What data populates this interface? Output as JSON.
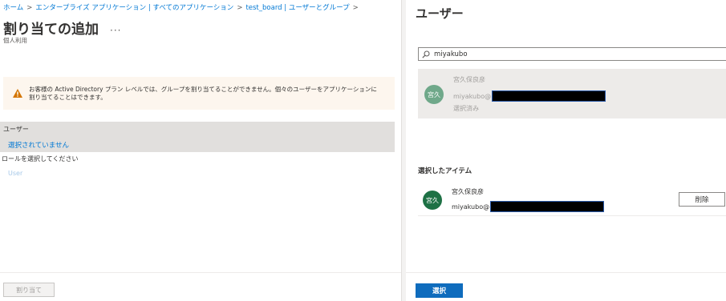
{
  "breadcrumb": {
    "items": [
      "ホーム",
      "エンタープライズ アプリケーション | すべてのアプリケーション",
      "test_board | ユーザーとグループ"
    ],
    "separator": ">"
  },
  "page": {
    "title": "割り当ての追加",
    "more": "···",
    "subtitle": "個人利用"
  },
  "warning": {
    "text": "お客様の Active Directory プラン レベルでは、グループを割り当てることができません。個々のユーザーをアプリケーションに割り当てることはできます。",
    "color": "#d47500"
  },
  "assignment": {
    "users_label": "ユーザー",
    "users_value": "選択されていません",
    "role_label": "ロールを選択してください",
    "role_value": "User"
  },
  "left_footer": {
    "assign_label": "割り当て"
  },
  "panel": {
    "title": "ユーザー",
    "search": {
      "value": "miyakubo",
      "icon": "search-icon"
    },
    "result": {
      "initials": "宮久",
      "name": "宮久保良彦",
      "email_prefix": "miyakubo@",
      "status": "選択済み"
    },
    "selected_label": "選択したアイテム",
    "selected_items": [
      {
        "initials": "宮久",
        "name": "宮久保良彦",
        "email_prefix": "miyakubo@",
        "remove_label": "削除"
      }
    ],
    "select_label": "選択"
  },
  "colors": {
    "accent": "#0078d4",
    "primary_button": "#0f6cbd",
    "avatar": "#1e7145",
    "warning_bg": "#fdf6ee"
  }
}
